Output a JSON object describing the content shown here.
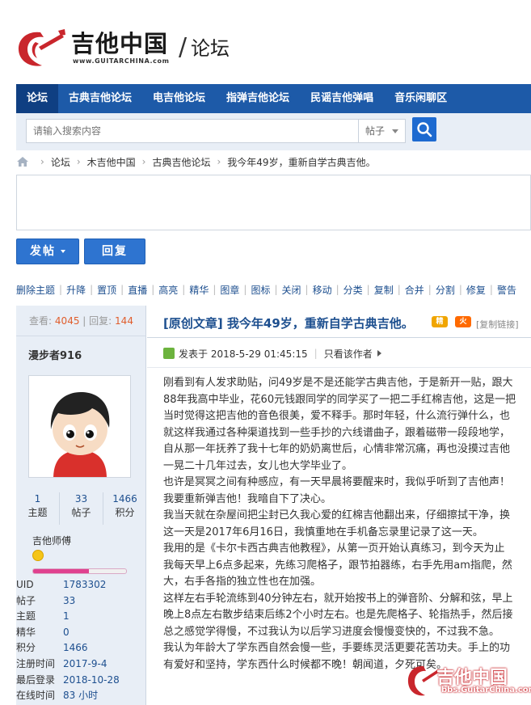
{
  "logo": {
    "name_cn": "吉他中国",
    "url": "www.GUITARCHINA.com",
    "separator": "/",
    "section": "论坛"
  },
  "nav": {
    "items": [
      {
        "label": "论坛",
        "active": true
      },
      {
        "label": "古典吉他论坛"
      },
      {
        "label": "电吉他论坛"
      },
      {
        "label": "指弹吉他论坛"
      },
      {
        "label": "民谣吉他弹唱"
      },
      {
        "label": "音乐闲聊区"
      }
    ]
  },
  "search": {
    "placeholder": "请输入搜索内容",
    "scope": "帖子",
    "icon": "search-icon"
  },
  "breadcrumb": {
    "items": [
      "论坛",
      "木吉他中国",
      "古典吉他论坛",
      "我今年49岁，重新自学古典吉他。"
    ],
    "separator": "›"
  },
  "actions": {
    "post_label": "发帖",
    "reply_label": "回复"
  },
  "moderation": {
    "items": [
      "删除主题",
      "升降",
      "置顶",
      "直播",
      "高亮",
      "精华",
      "图章",
      "图标",
      "关闭",
      "移动",
      "分类",
      "复制",
      "合并",
      "分割",
      "修复",
      "警告"
    ],
    "separator": "|"
  },
  "thread_stats": {
    "views_label": "查看:",
    "views": "4045",
    "divider": "|",
    "replies_label": "回复:",
    "replies": "144"
  },
  "author": {
    "name": "漫步者916",
    "counts": [
      {
        "value": "1",
        "label": "主题"
      },
      {
        "value": "33",
        "label": "帖子"
      },
      {
        "value": "1466",
        "label": "积分"
      }
    ],
    "rank": "吉他师傅",
    "rank_icon": "smiley-icon",
    "exp_fraction": 0.6,
    "info": [
      {
        "key": "UID",
        "value": "1783302"
      },
      {
        "key": "帖子",
        "value": "33"
      },
      {
        "key": "主题",
        "value": "1"
      },
      {
        "key": "精华",
        "value": "0"
      },
      {
        "key": "积分",
        "value": "1466"
      },
      {
        "key": "注册时间",
        "value": "2017-9-4"
      },
      {
        "key": "最后登录",
        "value": "2018-10-28"
      },
      {
        "key": "在线时间",
        "value": "83 小时"
      }
    ]
  },
  "post": {
    "title": "[原创文章] 我今年49岁，重新自学古典吉他。",
    "badge_essence": "精",
    "badge_hot": "火",
    "copy_link": "[复制链接]",
    "posted_on": "发表于 2018-5-29 01:45:15",
    "meta_divider": "|",
    "only_author": "只看该作者",
    "body": [
      "刚看到有人发求助贴，问49岁是不是还能学古典吉他，于是新开一贴，跟大",
      "88年我高中毕业，花60元钱跟同学的同学买了一把二手红棉吉他，这是一把",
      "当时觉得这把吉他的音色很美，爱不释手。那时年轻，什么流行弹什么，也",
      "就这样我通过各种渠道找到一些手抄的六线谱曲子，跟着磁带一段段地学，",
      "自从那一年抚养了我十七年的奶奶离世后，心情非常沉痛，再也没摸过吉他",
      "一晃二十几年过去，女儿也大学毕业了。",
      "也许是冥冥之间有种感应，有一天早晨将要醒来时，我似乎听到了吉他声！",
      "我要重新弹吉他！我暗自下了决心。",
      "我当天就在杂屋间把尘封已久我心爱的红棉吉他翻出来，仔细擦拭干净，换",
      "这一天是2017年6月16日，我慎重地在手机备忘录里记录了这一天。",
      "我用的是《卡尔卡西古典吉他教程》，从第一页开始认真练习，到今天为止",
      "我每天早上6点多起来，先练习爬格子，跟节拍器练，右手先用am指爬，然",
      "大，右手各指的独立性也在加强。",
      "这样左右手轮流练到40分钟左右，就开始按书上的弹音阶、分解和弦，早上",
      "晚上8点左右散步结束后练2个小时左右。也是先爬格子、轮指热手，然后接",
      "总之感觉学得慢，不过我认为以后学习进度会慢慢变快的，不过我不急。",
      "我认为年龄大了学东西自然会慢一些，手要练灵活更要花苦功夫。手上的功",
      "有爱好和坚持，学东西什么时候都不晚！朝闻道，夕死可矣。"
    ]
  },
  "watermark": {
    "text": "吉他中国",
    "url": "bbs.GuitarChina.com"
  },
  "colors": {
    "nav_bg": "#1d5aa8",
    "nav_active": "#0f3f82",
    "link": "#1d4f8f",
    "accent_red": "#c9262c",
    "button_blue": "#2e74d0",
    "stat_orange": "#e05d2c"
  }
}
